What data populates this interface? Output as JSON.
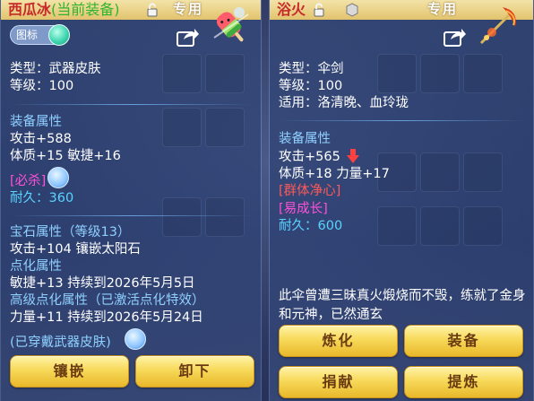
{
  "left_panel": {
    "name": "西瓜冰",
    "equipped_tag": "(当前装备)",
    "exclusive": "专用",
    "icon_toggle_label": "图标",
    "type_line": "类型：武器皮肤",
    "level_line": "等级：100",
    "equip_attr_header": "装备属性",
    "attack_line": "攻击+588",
    "stat_line": "体质+15 敏捷+16",
    "must_kill": "[必杀]",
    "durability_line": "耐久：360",
    "gem_header": "宝石属性（等级13）",
    "gem_line": "攻击+104 镶嵌太阳石",
    "enchant_header": "点化属性",
    "enchant_line": "敏捷+13 持续到2026年5月5日",
    "adv_enchant_header": "高级点化属性（已激活点化特效）",
    "adv_enchant_line": "力量+11 持续到2026年5月24日",
    "worn_skin": "(已穿戴武器皮肤)",
    "buttons": {
      "inlay": "镶嵌",
      "unequip": "卸下"
    }
  },
  "right_panel": {
    "name": "浴火",
    "exclusive": "专用",
    "type_line": "类型：伞剑",
    "level_line": "等级：100",
    "suit_line": "适用：洛清晚、血玲珑",
    "equip_attr_header": "装备属性",
    "attack_line": "攻击+565",
    "stat_line": "体质+18 力量+17",
    "group_purify": "[群体净心]",
    "easy_growth": "[易成长]",
    "durability_line": "耐久：600",
    "description": "此伞曾遭三昧真火煅烧而不毁，练就了金身和元神，已然通玄",
    "buttons": {
      "refine": "炼化",
      "equip": "装备",
      "donate": "捐献",
      "extract": "提炼"
    }
  },
  "colors": {
    "title_bar": "#e9cc7a",
    "name_red": "#c72a2a",
    "equipped_green": "#2fb52f",
    "header_blue": "#8fd0ff",
    "magenta": "#ff4fd8",
    "cyan": "#59d3ff",
    "button_gold": "#f7d95a"
  },
  "icons": [
    "lock-icon",
    "share-icon",
    "refresh-icon",
    "down-arrow-icon",
    "watermelon-ice-icon",
    "fire-umbrella-sword-icon"
  ]
}
